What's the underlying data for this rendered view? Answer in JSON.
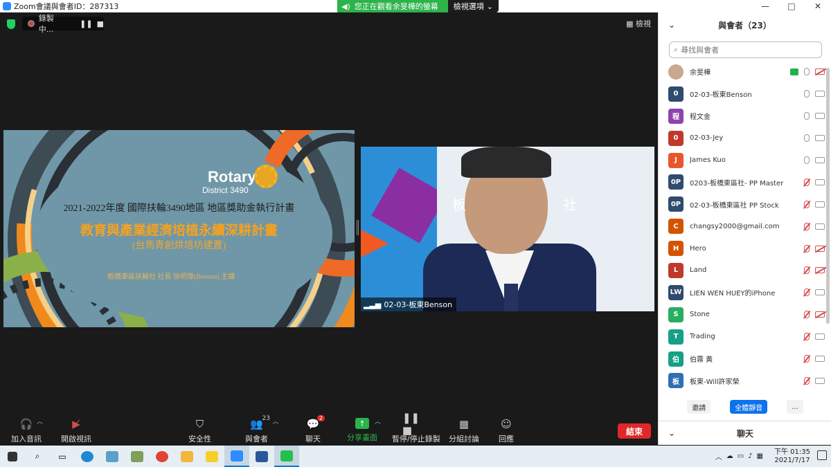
{
  "window": {
    "title": "Zoom會議與會者ID：287313",
    "share_banner": "您正在觀看余旻樺的螢幕",
    "view_options": "檢視選項",
    "controls": [
      "—",
      "□",
      "✕"
    ]
  },
  "recording": {
    "label": "錄製中...",
    "pause": "❚❚",
    "stop": "■"
  },
  "view_button": "檢視",
  "slide": {
    "brand": "Rotary",
    "district": "District 3490",
    "line1": "2021-2022年度 國際扶輪3490地區 地區獎助金執行計畫",
    "line2": "教育與產業經濟培植永續深耕計畫",
    "line3": "(台馬青創烘培坊建置)",
    "line4": "板橋東區扶輪社  社長 徐明偉(Benson) 主講"
  },
  "video": {
    "name": "02-03-板東Benson",
    "bg_text_left": "板",
    "bg_text_right": "社"
  },
  "toolbar": {
    "items": [
      {
        "label": "加入音訊",
        "icon": "headphone-icon"
      },
      {
        "label": "開啟視訊",
        "icon": "video-off-icon"
      },
      {
        "label": "安全性",
        "icon": "shield-icon"
      },
      {
        "label": "與會者",
        "icon": "participants-icon",
        "count": "23"
      },
      {
        "label": "聊天",
        "icon": "chat-icon",
        "badge": "2"
      },
      {
        "label": "分享畫面",
        "icon": "share-screen-icon"
      },
      {
        "label": "暫停/停止錄製",
        "icon": "pause-stop-icon"
      },
      {
        "label": "分組討論",
        "icon": "breakout-icon"
      },
      {
        "label": "回應",
        "icon": "reaction-icon"
      }
    ],
    "end": "結束"
  },
  "panel": {
    "title": "與會者（23）",
    "search_placeholder": "尋找與會者",
    "participants": [
      {
        "name": "余旻樺",
        "initial": "",
        "color": "#c9a98d",
        "sharing": true,
        "mic": "on",
        "cam": "off"
      },
      {
        "name": "02-03-板東Benson",
        "initial": "0",
        "color": "#2f4b6e",
        "mic": "on",
        "cam": "on"
      },
      {
        "name": "程文金",
        "initial": "程",
        "color": "#8e44ad",
        "mic": "on",
        "cam": "on"
      },
      {
        "name": "02-03-Jey",
        "initial": "0",
        "color": "#c0392b",
        "mic": "on",
        "cam": "on"
      },
      {
        "name": "James Kuo",
        "initial": "J",
        "color": "#e8572c",
        "mic": "on",
        "cam": "on"
      },
      {
        "name": "0203-板橋東區社- PP Master",
        "initial": "0P",
        "color": "#2f4b6e",
        "mic": "off",
        "cam": "on"
      },
      {
        "name": "02-03-板橋東區社 PP Stock",
        "initial": "0P",
        "color": "#2f4b6e",
        "mic": "off",
        "cam": "on"
      },
      {
        "name": "changsy2000@gmail.com",
        "initial": "C",
        "color": "#d35400",
        "mic": "off",
        "cam": "on"
      },
      {
        "name": "Hero",
        "initial": "H",
        "color": "#d35400",
        "mic": "off",
        "cam": "off"
      },
      {
        "name": "Land",
        "initial": "L",
        "color": "#c0392b",
        "mic": "off",
        "cam": "off"
      },
      {
        "name": "LIEN WEN HUEY的iPhone",
        "initial": "LW",
        "color": "#2f4b6e",
        "mic": "off",
        "cam": "on"
      },
      {
        "name": "Stone",
        "initial": "S",
        "color": "#27ae60",
        "mic": "off",
        "cam": "off"
      },
      {
        "name": "Trading",
        "initial": "T",
        "color": "#16a085",
        "mic": "off",
        "cam": "on"
      },
      {
        "name": "伯霧 黃",
        "initial": "伯",
        "color": "#16a085",
        "mic": "off",
        "cam": "on"
      },
      {
        "name": "板東-Will許家榮",
        "initial": "板",
        "color": "#2f6fb5",
        "mic": "off",
        "cam": "on"
      }
    ],
    "invite": "邀請",
    "mute_all": "全體靜音",
    "more": "...",
    "chat_title": "聊天"
  },
  "taskbar": {
    "time": "下午 01:35",
    "date": "2021/7/17"
  }
}
